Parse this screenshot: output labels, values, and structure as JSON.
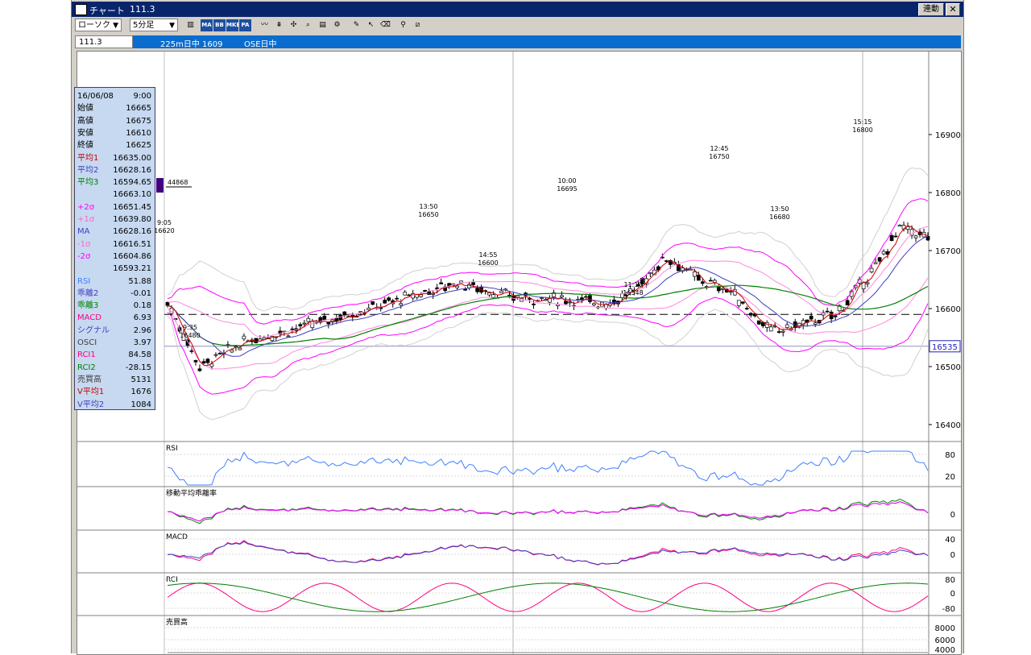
{
  "window": {
    "title": "チャート",
    "code_title": "111.3",
    "link_button": "連動",
    "close_icon": "close-icon"
  },
  "toolbar": {
    "chart_type": "ローソク",
    "interval": "5分足",
    "buttons": [
      "candle-style-icon",
      "MA",
      "BB",
      "MKE",
      "PA",
      "line-icon",
      "fibonacci-icon",
      "crosshair-icon",
      "zoom-icon",
      "print-icon",
      "settings-icon",
      "pen-icon",
      "pointer-icon",
      "eraser-icon",
      "find-icon",
      "trend-icon"
    ]
  },
  "infobar": {
    "code": "111.3",
    "name": "225m日中 1609",
    "market": "OSE日中"
  },
  "panel": {
    "rows": [
      {
        "label": "16/06/08",
        "value": "9:00",
        "color": "#000000"
      },
      {
        "label": "始値",
        "value": "16665",
        "color": "#000000"
      },
      {
        "label": "高値",
        "value": "16675",
        "color": "#000000"
      },
      {
        "label": "安値",
        "value": "16610",
        "color": "#000000"
      },
      {
        "label": "終値",
        "value": "16625",
        "color": "#000000"
      },
      {
        "label": "平均1",
        "value": "16635.00",
        "color": "#cc0000"
      },
      {
        "label": "平均2",
        "value": "16628.16",
        "color": "#4040c0"
      },
      {
        "label": "平均3",
        "value": "16594.65",
        "color": "#008000"
      },
      {
        "label": "",
        "value": "16663.10",
        "color": "#000000"
      },
      {
        "label": "+2σ",
        "value": "16651.45",
        "color": "#ff00ff"
      },
      {
        "label": "+1σ",
        "value": "16639.80",
        "color": "#ff66cc"
      },
      {
        "label": "MA",
        "value": "16628.16",
        "color": "#4040c0"
      },
      {
        "label": "-1σ",
        "value": "16616.51",
        "color": "#ff66cc"
      },
      {
        "label": "-2σ",
        "value": "16604.86",
        "color": "#ff00ff"
      },
      {
        "label": "",
        "value": "16593.21",
        "color": "#000000"
      },
      {
        "label": "RSI",
        "value": "51.88",
        "color": "#4080ff"
      },
      {
        "label": "乖離2",
        "value": "-0.01",
        "color": "#4040c0"
      },
      {
        "label": "乖離3",
        "value": "0.18",
        "color": "#008000"
      },
      {
        "label": "MACD",
        "value": "6.93",
        "color": "#ff0080"
      },
      {
        "label": "シグナル",
        "value": "2.96",
        "color": "#4040c0"
      },
      {
        "label": "OSCI",
        "value": "3.97",
        "color": "#404040"
      },
      {
        "label": "RCI1",
        "value": "84.58",
        "color": "#ff0080"
      },
      {
        "label": "RCI2",
        "value": "-28.15",
        "color": "#008000"
      },
      {
        "label": "売買高",
        "value": "5131",
        "color": "#404040"
      },
      {
        "label": "V平均1",
        "value": "1676",
        "color": "#cc0000"
      },
      {
        "label": "V平均2",
        "value": "1084",
        "color": "#4040c0"
      }
    ]
  },
  "chart_data": {
    "type": "candlestick",
    "price_axis": {
      "ticks": [
        "16900",
        "16800",
        "16700",
        "16600",
        "16500",
        "16400"
      ],
      "current_price": "16535",
      "reference_line": "16590"
    },
    "volume_marker": "44868",
    "annotations": [
      {
        "time": "9:05",
        "price": "16620"
      },
      {
        "time": "9:35",
        "price": "16480"
      },
      {
        "time": "13:50",
        "price": "16650"
      },
      {
        "time": "14:55",
        "price": "16600"
      },
      {
        "time": "10:00",
        "price": "16695"
      },
      {
        "time": "11:10",
        "price": "16548"
      },
      {
        "time": "12:45",
        "price": "16750"
      },
      {
        "time": "13:50",
        "price": "16680"
      },
      {
        "time": "15:15",
        "price": "16800"
      }
    ],
    "subpanels": [
      {
        "name": "RSI",
        "ticks": [
          "80",
          "20"
        ]
      },
      {
        "name": "移動平均乖離率",
        "ticks": [
          "0"
        ]
      },
      {
        "name": "MACD",
        "ticks": [
          "40",
          "0"
        ]
      },
      {
        "name": "RCI",
        "ticks": [
          "80",
          "0",
          "-80"
        ]
      },
      {
        "name": "売買高",
        "ticks": [
          "8000",
          "6000",
          "4000"
        ]
      }
    ]
  }
}
